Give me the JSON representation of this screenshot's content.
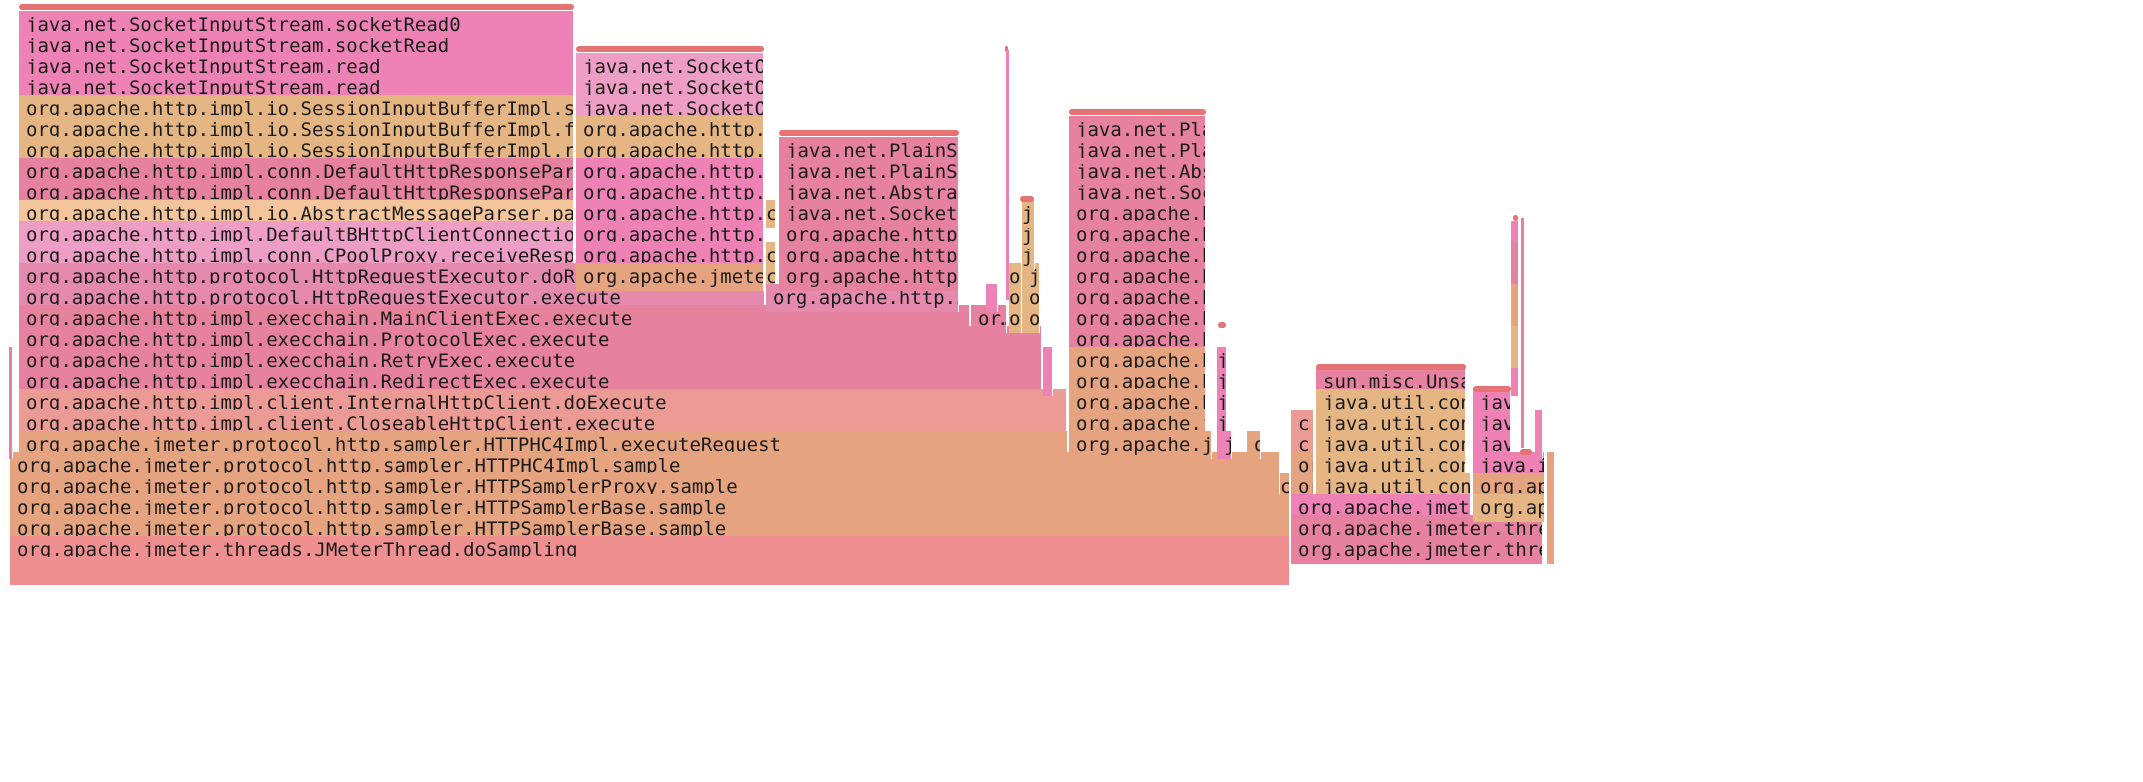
{
  "colors": {
    "pink": "#ee82b5",
    "pink_light": "#ee9ec4",
    "pink_mid": "#e589ad",
    "rose": "#e6829f",
    "salmon": "#ec9a94",
    "orange": "#e5a37f",
    "tan": "#e5b584",
    "peach": "#f4c59a",
    "coral": "#f08f8f",
    "ridge": "#e57373"
  },
  "labels": {
    "socketRead0": "java.net.SocketInputStream.socketRead0",
    "socketRead": "java.net.SocketInputStream.socketRead",
    "sisRead": "java.net.SocketInputStream.read",
    "streamRead": "org.apache.http.impl.io.SessionInputBufferImpl.streamRead",
    "fillBuffer": "org.apache.http.impl.io.SessionInputBufferImpl.fillBuffer",
    "readLine": "org.apache.http.impl.io.SessionInputBufferImpl.readLine",
    "parseHead": "org.apache.http.impl.conn.DefaultHttpResponseParser.parseHead",
    "amParse": "org.apache.http.impl.io.AbstractMessageParser.parse",
    "receiveRespHe": "org.apache.http.impl.DefaultBHttpClientConnection.receiveResponseHe…",
    "cpoolReceive": "org.apache.http.impl.conn.CPoolProxy.receiveResponseHeader",
    "doReceiveResponse": "org.apache.http.protocol.HttpRequestExecutor.doReceiveResponse",
    "hreExecute": "org.apache.http.protocol.HttpRequestExecutor.execute",
    "mainClientExec": "org.apache.http.impl.execchain.MainClientExec.execute",
    "protocolExec": "org.apache.http.impl.execchain.ProtocolExec.execute",
    "retryExec": "org.apache.http.impl.execchain.RetryExec.execute",
    "redirectExec": "org.apache.http.impl.execchain.RedirectExec.execute",
    "internalClient": "org.apache.http.impl.client.InternalHttpClient.doExecute",
    "closeableClient": "org.apache.http.impl.client.CloseableHttpClient.execute",
    "executeRequest": "org.apache.jmeter.protocol.http.sampler.HTTPHC4Impl.executeRequest",
    "hc4Sample": "org.apache.jmeter.protocol.http.sampler.HTTPHC4Impl.sample",
    "proxySample": "org.apache.jmeter.protocol.http.sampler.HTTPSamplerProxy.sample",
    "samplerBaseSample": "org.apache.jmeter.protocol.http.sampler.HTTPSamplerBase.sample",
    "doSampling": "org.apache.jmeter.threads.JMeterThread.doSampling",
    "sockOut": "java.net.SocketOutput…",
    "httpImplDots": "org.apache.http.impl.…",
    "jmeterPro": "org.apache.jmeter.pro…",
    "httpImplC": "org.apache.http.impl.c…",
    "plainSocketE": "java.net.PlainSocket…",
    "abstractPla": "java.net.AbstractPla…",
    "socketSetS": "java.net.Socket.setS…",
    "httpImpl2": "org.apache.http.impl…",
    "plainS": "java.net.PlainS…",
    "abstra": "java.net.Abstra…",
    "socketDot": "java.net.Socket…",
    "httpDots": "org.apache.http…",
    "jmeteDots": "org.apache.jmete…",
    "unsafe": "sun.misc.Unsafe…",
    "concur": "java.util.concur…",
    "concurr": "java.util.concurr…",
    "jmeterVi": "org.apache.jmeter.vi…",
    "threadsLis": "org.apache.jmeter.threads.Lis…",
    "threadsJMe": "org.apache.jmeter.threads.JMe…",
    "jav": "jav…",
    "javaI": "java.i…",
    "orgApa": "org.apa…",
    "orDots": "or…",
    "c": "c",
    "j": "j",
    "o": "o",
    "ja": "ja",
    "or": "or",
    "oDot": "o"
  }
}
